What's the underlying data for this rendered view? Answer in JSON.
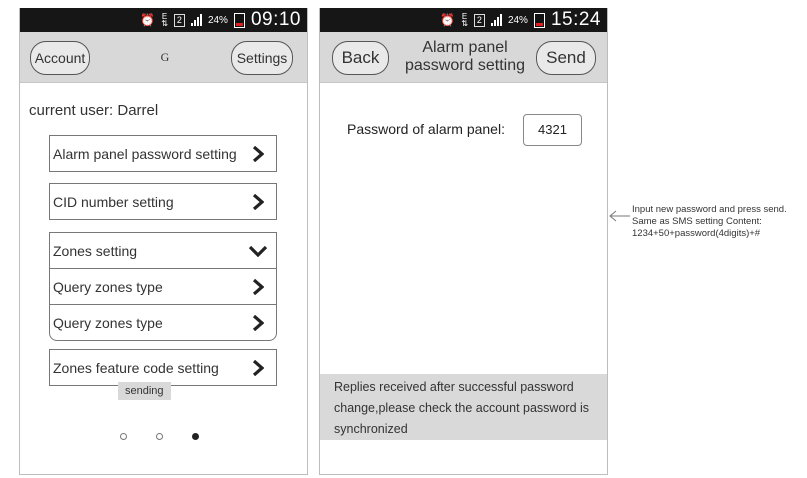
{
  "phone1": {
    "status": {
      "time": "09:10",
      "battery_pct": "24%",
      "sim": "2",
      "net": "E"
    },
    "header": {
      "left_button": "Account",
      "title": "G",
      "right_button": "Settings"
    },
    "current_user": "current user: Darrel",
    "menu": {
      "alarm_password": "Alarm panel password setting",
      "cid_number": "CID number setting",
      "zones_setting": "Zones setting",
      "query_zones_1": "Query zones type",
      "query_zones_2": "Query zones type",
      "zones_feature": "Zones feature code setting"
    },
    "toast": "sending",
    "page_indicator": {
      "count": 3,
      "active": 3
    }
  },
  "phone2": {
    "status": {
      "time": "15:24",
      "battery_pct": "24%",
      "sim": "2",
      "net": "E"
    },
    "header": {
      "left_button": "Back",
      "title_line1": "Alarm panel",
      "title_line2": "password setting",
      "right_button": "Send"
    },
    "password_label": "Password of alarm panel:",
    "password_value": "4321",
    "reply_message": "Replies received after successful password change,please check the account password is synchronized"
  },
  "annotation": {
    "line1": "Input new password and press send.",
    "line2": "Same as SMS setting Content:",
    "line3": "1234+50+password(4digits)+#"
  },
  "colors": {
    "status_bar": "#161616",
    "title_bar": "#d8d8d8",
    "reply_bg": "#d9d9d9",
    "battery_low": "#e02020"
  }
}
